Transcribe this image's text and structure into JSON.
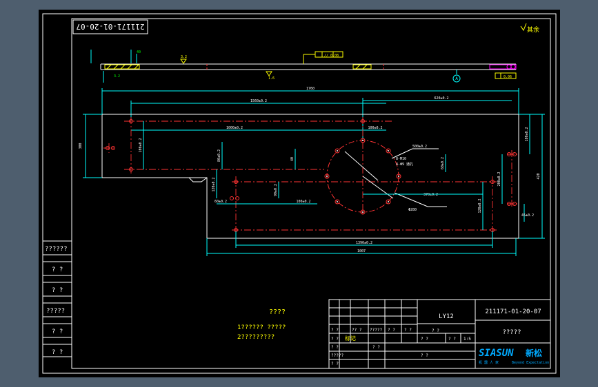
{
  "drawing_number_rotated": "211171-01-20-07",
  "surface_finish_note": "其余",
  "roughness_values": [
    "6.3",
    "3.2",
    "1.6"
  ],
  "feature_frames": [
    "// 0.08",
    "0.06"
  ],
  "datum_label": "A",
  "dimensions": {
    "overall_length": "1760",
    "overall_height": "420",
    "hole_span_main": "1560±0.2",
    "hole_span_lower": "1390±0.2",
    "hole_span_middle": "1000±0.2",
    "right_offset": "620±0.2",
    "left_height": "300",
    "vertical_a": "100±0.2",
    "vertical_b": "80±0.2",
    "vertical_c": "120±0.2",
    "small_a": "100±0.2",
    "small_b": "90±0.2",
    "small_c": "40",
    "bottom_length": "1007",
    "right_small": "60±0.2",
    "right_v1": "180±0.2",
    "right_v2": "200±0.2",
    "right_lower": "45±0.2",
    "bolt_circle": "Φ280",
    "hole_note": "8-M10",
    "hole_note2": "4-Φ9 通孔",
    "mid_dim": "500±0.2",
    "mid_dim2": "370±0.2"
  },
  "left_block": {
    "rows": [
      "??????",
      "? ?",
      "? ?",
      "?????",
      "? ?",
      "? ?"
    ]
  },
  "notes": {
    "heading": "????",
    "line1": "1?????? ?????",
    "line2": "2?????????"
  },
  "title_block": {
    "material": "LY12",
    "drawing_number": "211171-01-20-07",
    "part_name": "?????",
    "row_labels": [
      "? ?",
      "? ?",
      "? ?",
      "?????",
      "? ?",
      "? ?"
    ],
    "col_labels": [
      "?? ?",
      "? ?",
      "?????",
      "? ?",
      "? ?",
      "? ?"
    ],
    "scale_labels": [
      "? ?",
      "? ?",
      "? ?"
    ],
    "weight": "1:5",
    "sign_row": "? ?",
    "company_logo": "SIASUN",
    "company_cn": "新松",
    "slogan_cn": "机 器 人 家",
    "slogan_en": "Beyond Expectation",
    "stamp": "标记"
  }
}
